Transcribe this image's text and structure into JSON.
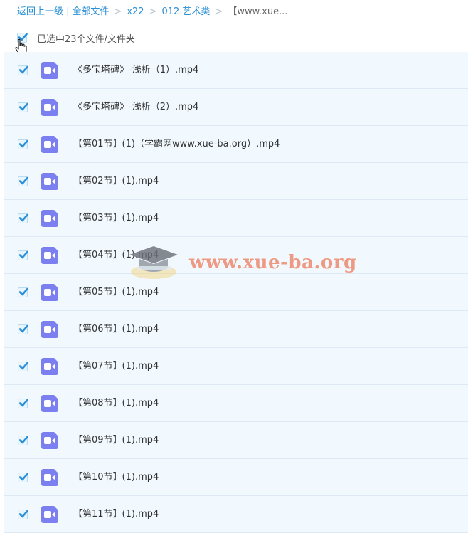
{
  "breadcrumb": {
    "back": "返回上一级",
    "all_files": "全部文件",
    "items": [
      "x22",
      "012 艺术类",
      "【www.xue..."
    ]
  },
  "select_all": {
    "label": "已选中23个文件/文件夹",
    "checked": true
  },
  "files": [
    {
      "name": "《多宝塔碑》-浅析（1）.mp4",
      "checked": true
    },
    {
      "name": "《多宝塔碑》-浅析（2）.mp4",
      "checked": true
    },
    {
      "name": "【第01节】(1)（学霸网www.xue-ba.org）.mp4",
      "checked": true
    },
    {
      "name": "【第02节】(1).mp4",
      "checked": true
    },
    {
      "name": "【第03节】(1).mp4",
      "checked": true
    },
    {
      "name": "【第04节】(1).mp4",
      "checked": true
    },
    {
      "name": "【第05节】(1).mp4",
      "checked": true
    },
    {
      "name": "【第06节】(1).mp4",
      "checked": true
    },
    {
      "name": "【第07节】(1).mp4",
      "checked": true
    },
    {
      "name": "【第08节】(1).mp4",
      "checked": true
    },
    {
      "name": "【第09节】(1).mp4",
      "checked": true
    },
    {
      "name": "【第10节】(1).mp4",
      "checked": true
    },
    {
      "name": "【第11节】(1).mp4",
      "checked": true
    }
  ],
  "file_icon": "video-file-icon",
  "watermark": {
    "text": "www.xue-ba.org",
    "icon": "graduation-cap-icon"
  },
  "colors": {
    "accent": "#2a8fd6",
    "row_bg": "#f1f9ff",
    "video_icon": "#7b7ff0",
    "check": "#2a8fd6"
  }
}
